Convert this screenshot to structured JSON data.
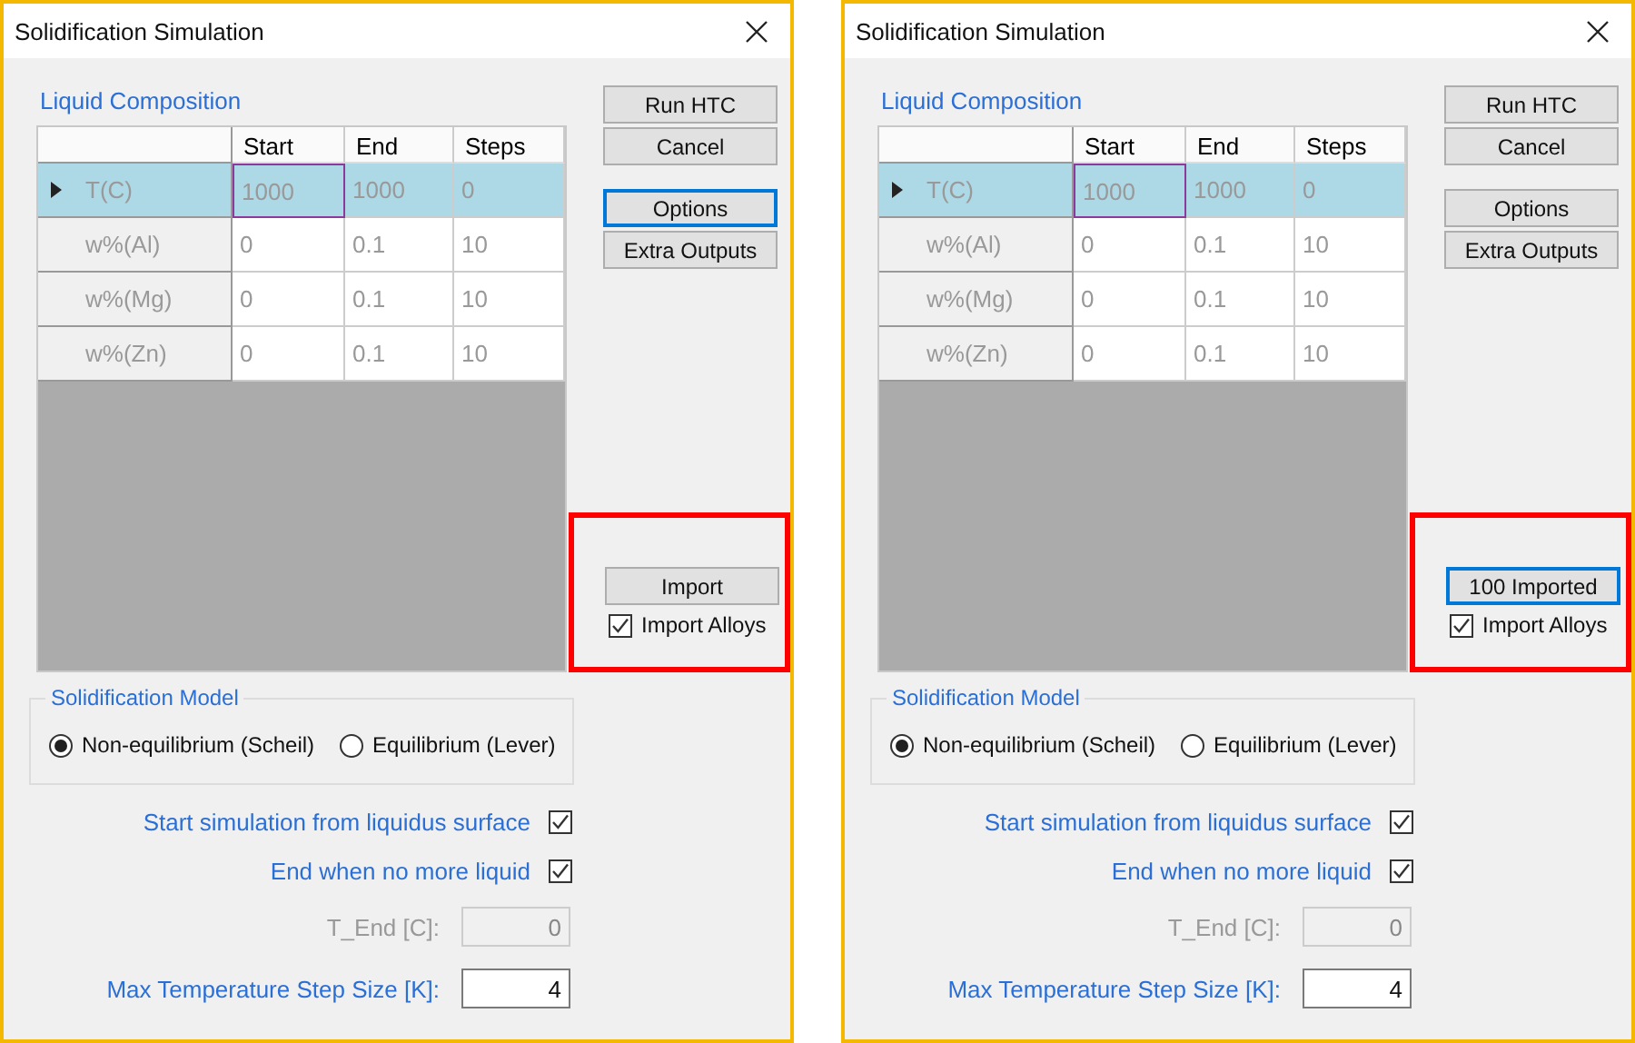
{
  "dialogs": [
    {
      "title": "Solidification Simulation",
      "liquid_composition": {
        "label": "Liquid Composition",
        "columns": [
          "Start",
          "End",
          "Steps"
        ],
        "rows": [
          {
            "name": "T(C)",
            "selected": true,
            "cells": [
              "1000",
              "1000",
              "0"
            ]
          },
          {
            "name": "w%(Al)",
            "selected": false,
            "cells": [
              "0",
              "0.1",
              "10"
            ]
          },
          {
            "name": "w%(Mg)",
            "selected": false,
            "cells": [
              "0",
              "0.1",
              "10"
            ]
          },
          {
            "name": "w%(Zn)",
            "selected": false,
            "cells": [
              "0",
              "0.1",
              "10"
            ]
          }
        ]
      },
      "button_groups": [
        [
          {
            "label": "Run HTC",
            "focused": false
          },
          {
            "label": "Cancel",
            "focused": false
          }
        ],
        [
          {
            "label": "Options",
            "focused": true
          },
          {
            "label": "Extra Outputs",
            "focused": false
          }
        ]
      ],
      "import": {
        "highlighted": true,
        "button": {
          "label": "Import",
          "focused": false
        },
        "checkbox": {
          "label": "Import Alloys",
          "checked": true
        }
      },
      "model": {
        "label": "Solidification Model",
        "options": [
          {
            "label": "Non-equilibrium (Scheil)",
            "selected": true
          },
          {
            "label": "Equilibrium (Lever)",
            "selected": false
          }
        ]
      },
      "options": [
        {
          "label": "Start simulation from liquidus surface",
          "checked": true
        },
        {
          "label": "End when no more liquid",
          "checked": true
        }
      ],
      "fields": [
        {
          "label": "T_End [C]:",
          "value": "0",
          "disabled": true
        },
        {
          "label": "Max Temperature Step Size [K]:",
          "value": "4",
          "disabled": false
        }
      ]
    },
    {
      "title": "Solidification Simulation",
      "liquid_composition": {
        "label": "Liquid Composition",
        "columns": [
          "Start",
          "End",
          "Steps"
        ],
        "rows": [
          {
            "name": "T(C)",
            "selected": true,
            "cells": [
              "1000",
              "1000",
              "0"
            ]
          },
          {
            "name": "w%(Al)",
            "selected": false,
            "cells": [
              "0",
              "0.1",
              "10"
            ]
          },
          {
            "name": "w%(Mg)",
            "selected": false,
            "cells": [
              "0",
              "0.1",
              "10"
            ]
          },
          {
            "name": "w%(Zn)",
            "selected": false,
            "cells": [
              "0",
              "0.1",
              "10"
            ]
          }
        ]
      },
      "button_groups": [
        [
          {
            "label": "Run HTC",
            "focused": false
          },
          {
            "label": "Cancel",
            "focused": false
          }
        ],
        [
          {
            "label": "Options",
            "focused": false
          },
          {
            "label": "Extra Outputs",
            "focused": false
          }
        ]
      ],
      "import": {
        "highlighted": true,
        "button": {
          "label": "100 Imported",
          "focused": true
        },
        "checkbox": {
          "label": "Import Alloys",
          "checked": true
        }
      },
      "model": {
        "label": "Solidification Model",
        "options": [
          {
            "label": "Non-equilibrium (Scheil)",
            "selected": true
          },
          {
            "label": "Equilibrium (Lever)",
            "selected": false
          }
        ]
      },
      "options": [
        {
          "label": "Start simulation from liquidus surface",
          "checked": true
        },
        {
          "label": "End when no more liquid",
          "checked": true
        }
      ],
      "fields": [
        {
          "label": "T_End [C]:",
          "value": "0",
          "disabled": true
        },
        {
          "label": "Max Temperature Step Size [K]:",
          "value": "4",
          "disabled": false
        }
      ]
    }
  ]
}
